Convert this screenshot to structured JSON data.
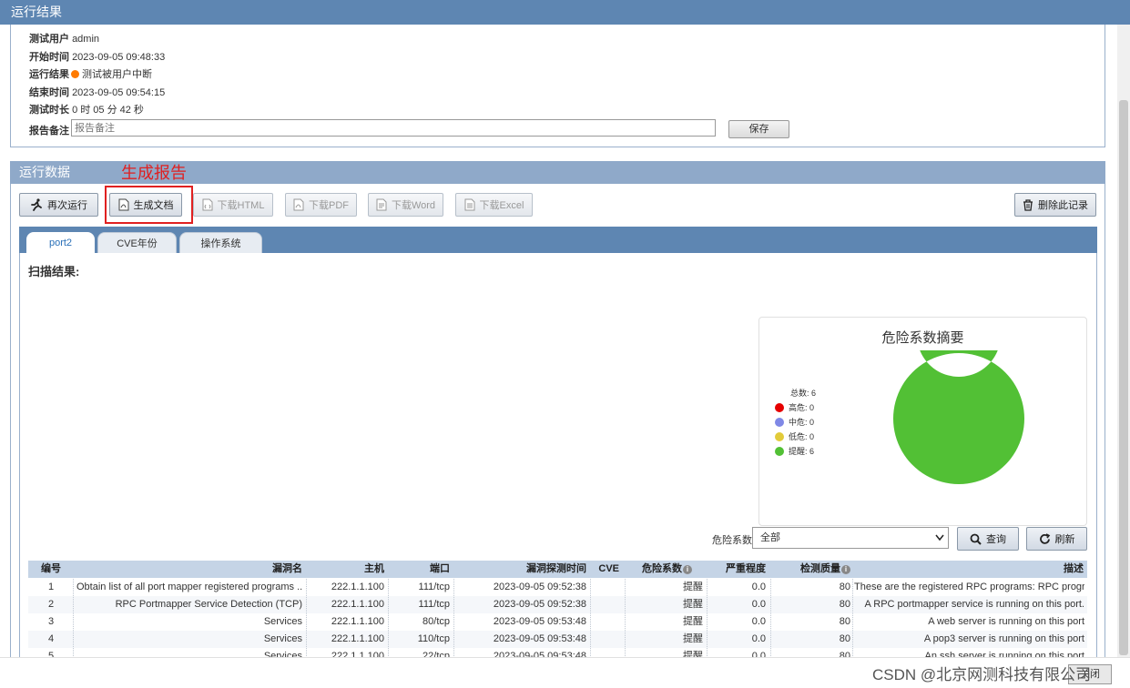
{
  "top": {
    "title": "运行结果"
  },
  "info": {
    "user_label": "测试用户",
    "user_value": "admin",
    "start_label": "开始时间",
    "start_value": "2023-09-05 09:48:33",
    "result_label": "运行结果",
    "result_value": "测试被用户中断",
    "end_label": "结束时间",
    "end_value": "2023-09-05 09:54:15",
    "duration_label": "测试时长",
    "duration_value": "0 时 05 分 42 秒",
    "note_label": "报告备注",
    "note_placeholder": "报告备注",
    "save_label": "保存"
  },
  "run_data": {
    "title": "运行数据",
    "annotation": "生成报告"
  },
  "toolbar": {
    "rerun": "再次运行",
    "generate_doc": "生成文档",
    "download_html": "下载HTML",
    "download_pdf": "下载PDF",
    "download_word": "下载Word",
    "download_excel": "下载Excel",
    "delete_record": "删除此记录"
  },
  "tabs": [
    {
      "label": "port2"
    },
    {
      "label": "CVE年份"
    },
    {
      "label": "操作系统"
    }
  ],
  "scan": {
    "label": "扫描结果:"
  },
  "chart_data": {
    "type": "pie",
    "title": "危险系数摘要",
    "total_label": "总数: 6",
    "categories": [
      "高危",
      "中危",
      "低危",
      "提醒"
    ],
    "values": [
      0,
      0,
      0,
      6
    ],
    "legend": [
      "高危: 0",
      "中危: 0",
      "低危: 0",
      "提醒: 6"
    ],
    "colors": [
      "#e60000",
      "#7f88e6",
      "#e2cb3a",
      "#52c035"
    ],
    "donut": true
  },
  "filter": {
    "label": "危险系数",
    "selected": "全部",
    "query": "查询",
    "refresh": "刷新"
  },
  "table": {
    "headers": [
      "编号",
      "漏洞名",
      "主机",
      "端口",
      "漏洞探测时间",
      "CVE",
      "危险系数",
      "严重程度",
      "检测质量",
      "描述"
    ],
    "rows": [
      [
        "1",
        "Obtain list of all port mapper registered programs ...",
        "222.1.1.100",
        "111/tcp",
        "2023-09-05 09:52:38",
        "",
        "提醒",
        "0.0",
        "80",
        "These are the registered RPC programs: RPC progr..."
      ],
      [
        "2",
        "RPC Portmapper Service Detection (TCP)",
        "222.1.1.100",
        "111/tcp",
        "2023-09-05 09:52:38",
        "",
        "提醒",
        "0.0",
        "80",
        "A RPC portmapper service is running on this port."
      ],
      [
        "3",
        "Services",
        "222.1.1.100",
        "80/tcp",
        "2023-09-05 09:53:48",
        "",
        "提醒",
        "0.0",
        "80",
        "A web server is running on this port"
      ],
      [
        "4",
        "Services",
        "222.1.1.100",
        "110/tcp",
        "2023-09-05 09:53:48",
        "",
        "提醒",
        "0.0",
        "80",
        "A pop3 server is running on this port"
      ],
      [
        "5",
        "Services",
        "222.1.1.100",
        "22/tcp",
        "2023-09-05 09:53:48",
        "",
        "提醒",
        "0.0",
        "80",
        "An ssh server is running on this port"
      ]
    ]
  },
  "footer": {
    "watermark": "CSDN @北京网测科技有限公司",
    "close": "关闭"
  }
}
